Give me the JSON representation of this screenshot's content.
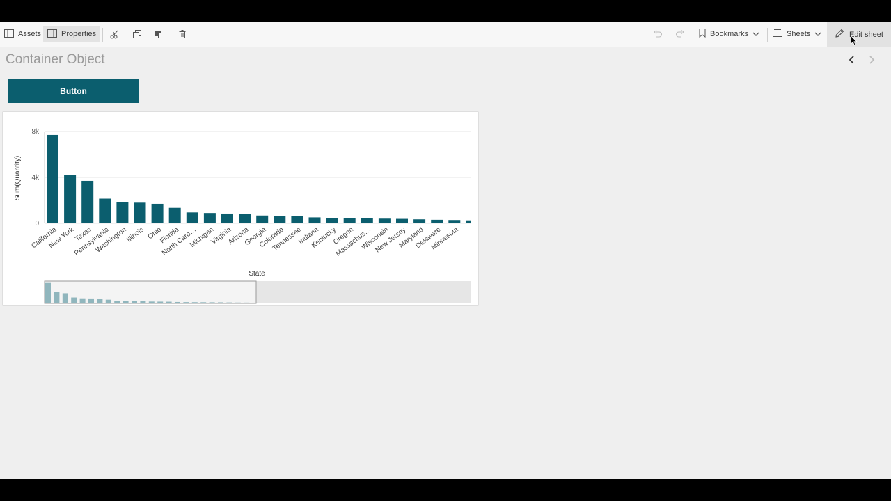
{
  "toolbar": {
    "assets_label": "Assets",
    "properties_label": "Properties",
    "bookmarks_label": "Bookmarks",
    "sheets_label": "Sheets",
    "edit_sheet_label": "Edit sheet"
  },
  "sheet": {
    "title": "Container Object",
    "button_label": "Button"
  },
  "colors": {
    "accent": "#0b5e6e",
    "bar": "#0b5e6e",
    "stage": "#efefef"
  },
  "chart_data": {
    "type": "bar",
    "title": "",
    "xlabel": "State",
    "ylabel": "Sum(Quantity)",
    "ylim": [
      0,
      8000
    ],
    "yticks": [
      {
        "value": 0,
        "label": "0"
      },
      {
        "value": 4000,
        "label": "4k"
      },
      {
        "value": 8000,
        "label": "8k"
      }
    ],
    "grid": true,
    "categories": [
      "California",
      "New York",
      "Texas",
      "Pennsylvania",
      "Washington",
      "Illinois",
      "Ohio",
      "Florida",
      "North Caro…",
      "Michigan",
      "Virginia",
      "Arizona",
      "Georgia",
      "Colorado",
      "Tennessee",
      "Indiana",
      "Kentucky",
      "Oregon",
      "Massachus…",
      "Wisconsin",
      "New Jersey",
      "Maryland",
      "Delaware",
      "Minnesota"
    ],
    "values": [
      7700,
      4200,
      3700,
      2150,
      1850,
      1800,
      1700,
      1350,
      950,
      900,
      850,
      820,
      680,
      650,
      620,
      520,
      470,
      450,
      430,
      410,
      390,
      350,
      310,
      290
    ],
    "partial_next_value": 260,
    "minimap_values": [
      7700,
      4200,
      3700,
      2150,
      1850,
      1800,
      1700,
      1350,
      950,
      900,
      850,
      820,
      680,
      650,
      620,
      520,
      470,
      450,
      430,
      410,
      390,
      350,
      310,
      290,
      260,
      240,
      220,
      200,
      180,
      170,
      160,
      150,
      140,
      130,
      120,
      110,
      100,
      95,
      90,
      85,
      80,
      75,
      70,
      65,
      60,
      55,
      50,
      45,
      40,
      35
    ]
  }
}
